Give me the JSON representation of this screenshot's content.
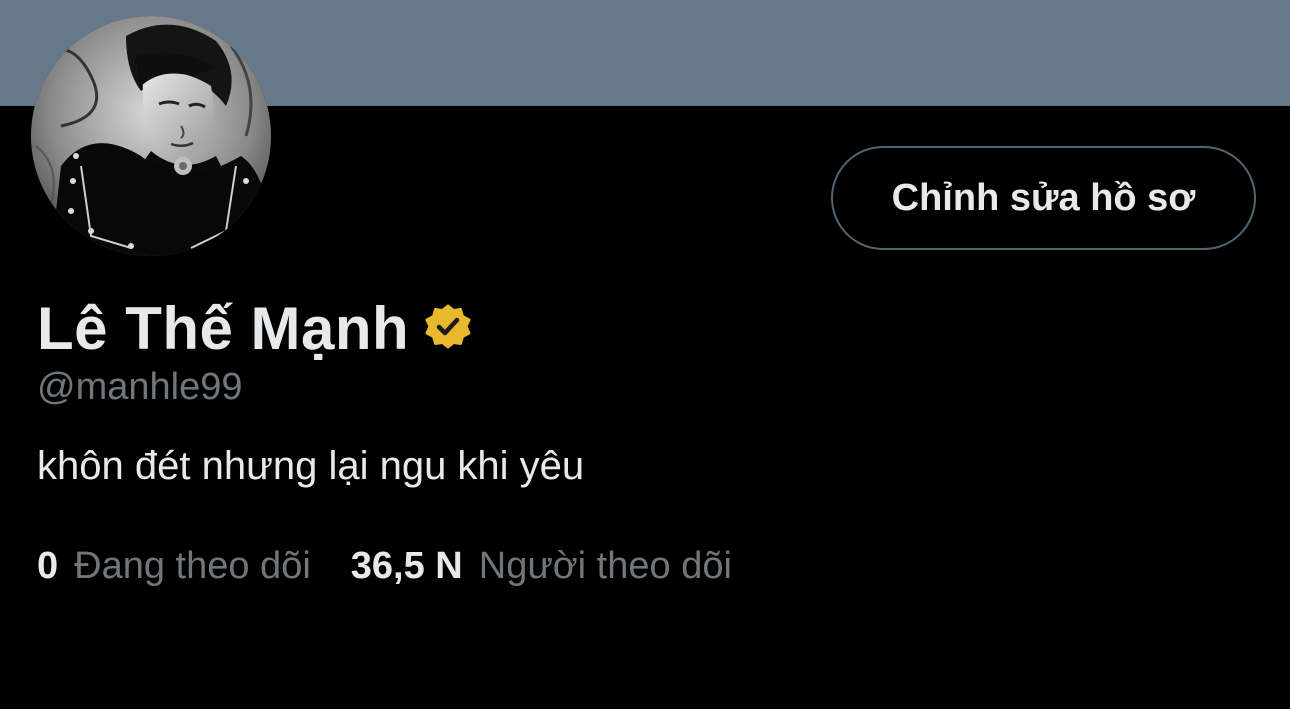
{
  "profile": {
    "display_name": "Lê Thế Mạnh",
    "handle": "@manhle99",
    "bio": "khôn đét nhưng lại ngu khi yêu",
    "verified_badge": "verified-gold-badge-icon",
    "edit_button_label": "Chỉnh sửa hồ sơ",
    "stats": {
      "following_count": "0",
      "following_label": "Đang theo dõi",
      "followers_count": "36,5 N",
      "followers_label": "Người theo dõi"
    }
  },
  "colors": {
    "background": "#000000",
    "banner": "#66788a",
    "primary_text": "#e7e9ea",
    "secondary_text": "#71767b",
    "button_border": "#536471",
    "badge_gold": "#e8b92c"
  }
}
